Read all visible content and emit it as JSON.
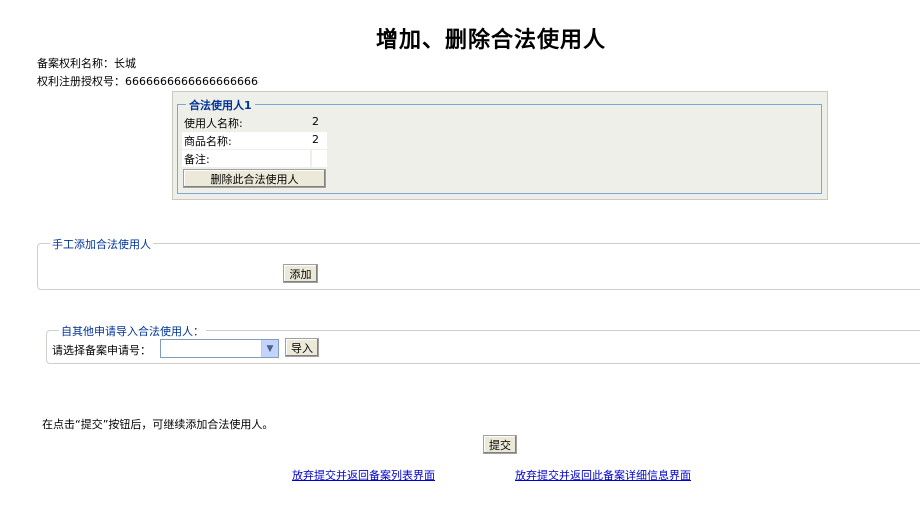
{
  "page": {
    "title": "增加、删除合法使用人"
  },
  "record": {
    "name_label": "备案权利名称：",
    "name_value": "长城",
    "reg_label": "权利注册授权号：",
    "reg_value": "6666666666666666666"
  },
  "user_box": {
    "legend": "合法使用人1",
    "rows": [
      {
        "label": "使用人名称:",
        "value": "2"
      },
      {
        "label": "商品名称:",
        "value": "2"
      },
      {
        "label": "备注:",
        "value": ""
      }
    ],
    "delete_label": "删除此合法使用人"
  },
  "manual_add": {
    "legend": "手工添加合法使用人",
    "add_label": "添加"
  },
  "import": {
    "legend": "自其他申请导入合法使用人：",
    "select_label": "请选择备案申请号：",
    "select_value": "",
    "import_label": "导入"
  },
  "footer": {
    "note": "在点击“提交”按钮后，可继续添加合法使用人。",
    "submit_label": "提交",
    "link_list": "放弃提交并返回备案列表界面",
    "link_detail": "放弃提交并返回此备案详细信息界面"
  }
}
